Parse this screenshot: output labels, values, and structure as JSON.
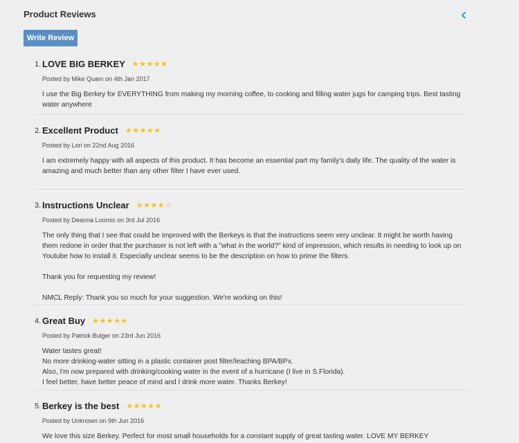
{
  "header": {
    "title": "Product Reviews",
    "collapse_icon": "chevron-left-icon",
    "accent": "#3a9ad9"
  },
  "toolbar": {
    "write_review_label": "Write Review",
    "button_color": "#5b8fc4"
  },
  "reviews": [
    {
      "num": "1.",
      "title": "LOVE BIG BERKEY",
      "rating": 5,
      "posted": "Posted by Mike Quam on 4th Jan 2017",
      "paragraphs": [
        "I use the Big Berkey for EVERYTHING from making my morning coffee, to cooking and filling water jugs for camping trips. Best tasting water anywhere"
      ]
    },
    {
      "num": "2.",
      "title": "Excellent Product",
      "rating": 5,
      "posted": "Posted by Lori on 22nd Aug 2016",
      "paragraphs": [
        "I am extremely happy with all aspects of this product. It has become an essential part my family's daily life. The quality of the water is amazing and much better than any other filter I have ever used."
      ]
    },
    {
      "num": "3.",
      "title": "Instructions Unclear",
      "rating": 4,
      "posted": "Posted by Deanna Loomis on 3rd Jul 2016",
      "paragraphs": [
        "The only thing that I see that could be improved with the Berkeys is that the instructions seem very unclear. It might be worth having them redone in order that the purchaser is not left with a \"what in the world?\" kind of impression, which results in needing to look up on Youtube how to install it. Especially unclear seems to be the description on how to prime the filters.",
        "Thank you for requesting my review!",
        "NMCL Reply: Thank you so much for your suggestion. We're working on this!"
      ]
    },
    {
      "num": "4.",
      "title": "Great Buy",
      "rating": 5,
      "posted": "Posted by Patrick Bulger on 23rd Jun 2016",
      "lines": [
        "Water tastes great!",
        "No more drinking-water sitting in a plastic container post filter/leaching BPA/BPx.",
        "Also, I'm now prepared with drinking/cooking water in the event of a hurricane (I live in S.Florida).",
        "I feel better, have better peace of mind and I drink more water. Thanks Berkey!"
      ]
    },
    {
      "num": "5.",
      "title": "Berkey is the best",
      "rating": 5,
      "posted": "Posted by Unknown on 9th Jun 2016",
      "paragraphs": [
        "We love this size Berkey. Perfect for most small households for a constant supply of great tasting water. LOVE MY BERKEY"
      ]
    }
  ],
  "colors": {
    "star": "#f0c419",
    "divider": "#dcdcdc",
    "background": "#efefef"
  }
}
